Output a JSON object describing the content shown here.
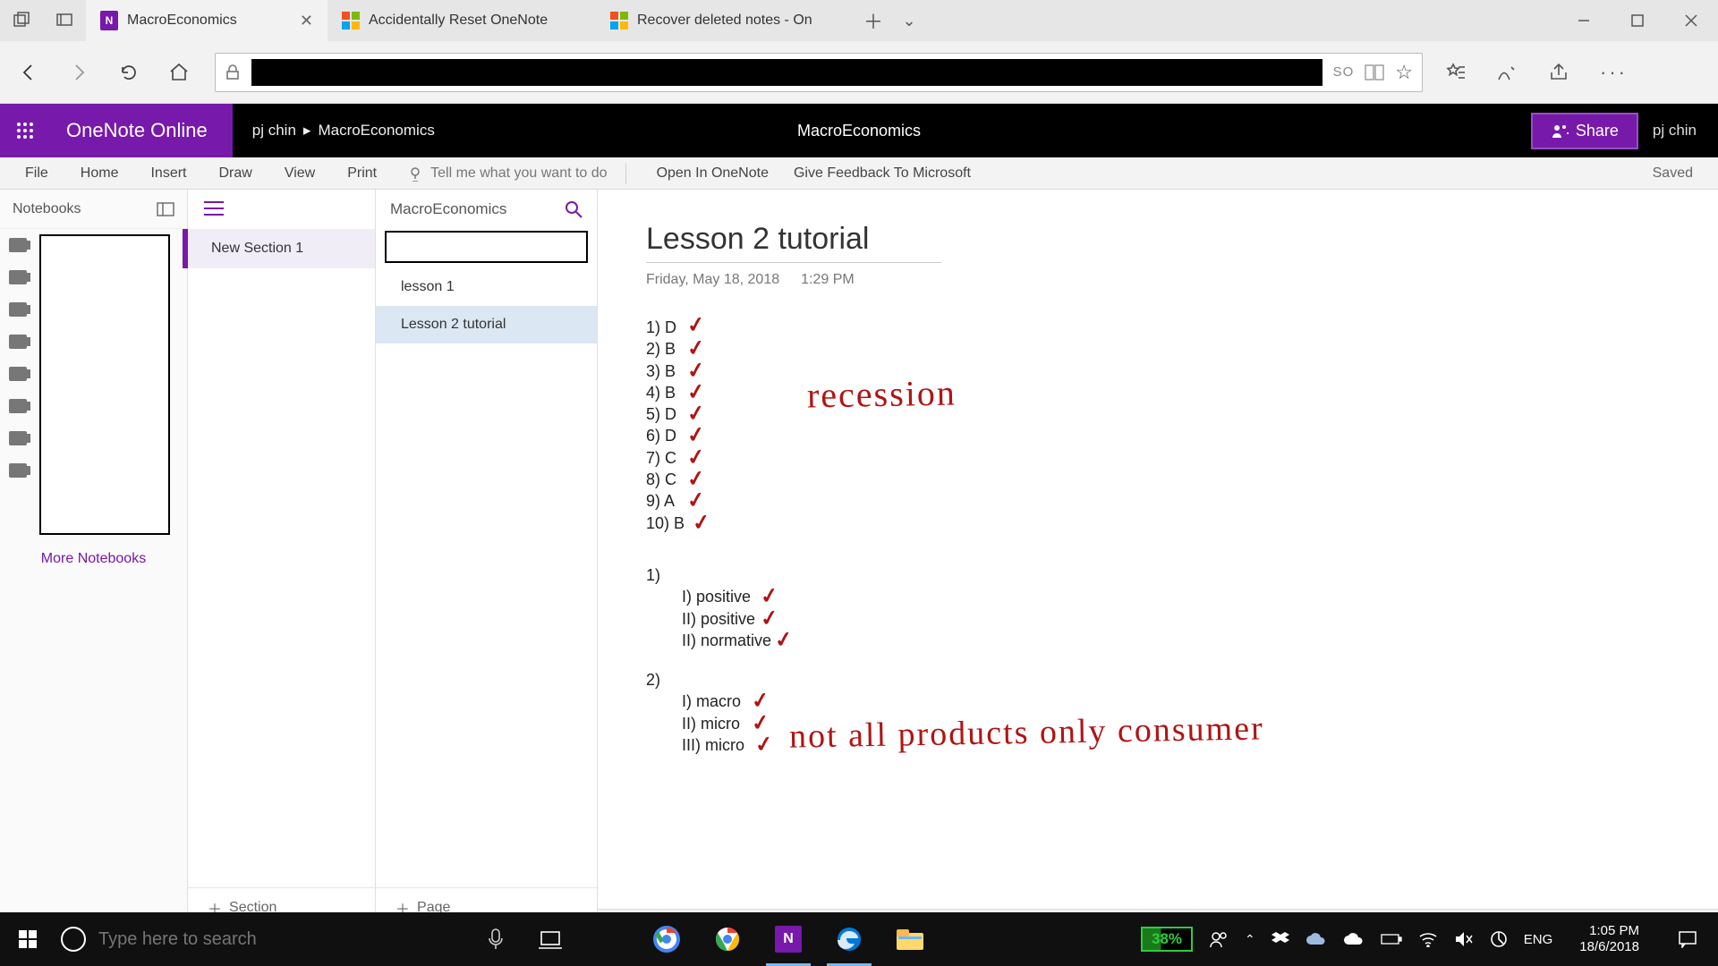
{
  "browser": {
    "tabs": [
      {
        "title": "MacroEconomics",
        "favicon": "onenote"
      },
      {
        "title": "Accidentally Reset OneNote",
        "favicon": "microsoft"
      },
      {
        "title": "Recover deleted notes - On",
        "favicon": "microsoft"
      }
    ],
    "address_hint": "SO"
  },
  "onenote": {
    "brand": "OneNote Online",
    "crumb_user": "pj chin",
    "crumb_notebook": "MacroEconomics",
    "doc_title": "MacroEconomics",
    "share_label": "Share",
    "user_label": "pj chin",
    "ribbon": {
      "tabs": [
        "File",
        "Home",
        "Insert",
        "Draw",
        "View",
        "Print"
      ],
      "tell_me": "Tell me what you want to do",
      "open_in": "Open In OneNote",
      "feedback": "Give Feedback To Microsoft",
      "saved": "Saved"
    },
    "notebooks_label": "Notebooks",
    "more_notebooks": "More Notebooks",
    "section_title": "MacroEconomics",
    "sections": [
      "New Section 1"
    ],
    "add_section": "Section",
    "pages": [
      "lesson 1",
      "Lesson 2 tutorial"
    ],
    "selected_page_index": 1,
    "add_page": "Page",
    "note": {
      "title": "Lesson 2 tutorial",
      "date": "Friday, May 18, 2018",
      "time": "1:29 PM",
      "answers_block1": [
        "1) D",
        "2) B",
        "3) B",
        "4) B",
        "5) D",
        "6) D",
        "7) C",
        "8) C",
        "9) A",
        "10) B"
      ],
      "q1_label": "1)",
      "q1_items": [
        "I) positive",
        "II) positive",
        "II) normative"
      ],
      "q2_label": "2)",
      "q2_items": [
        "I) macro",
        "II) micro",
        "III) micro"
      ],
      "ink_recession": "recession",
      "ink_note2": "not all products only consumer"
    }
  },
  "taskbar": {
    "search_placeholder": "Type here to search",
    "battery": "38%",
    "lang": "ENG",
    "time": "1:05 PM",
    "date": "18/6/2018"
  }
}
